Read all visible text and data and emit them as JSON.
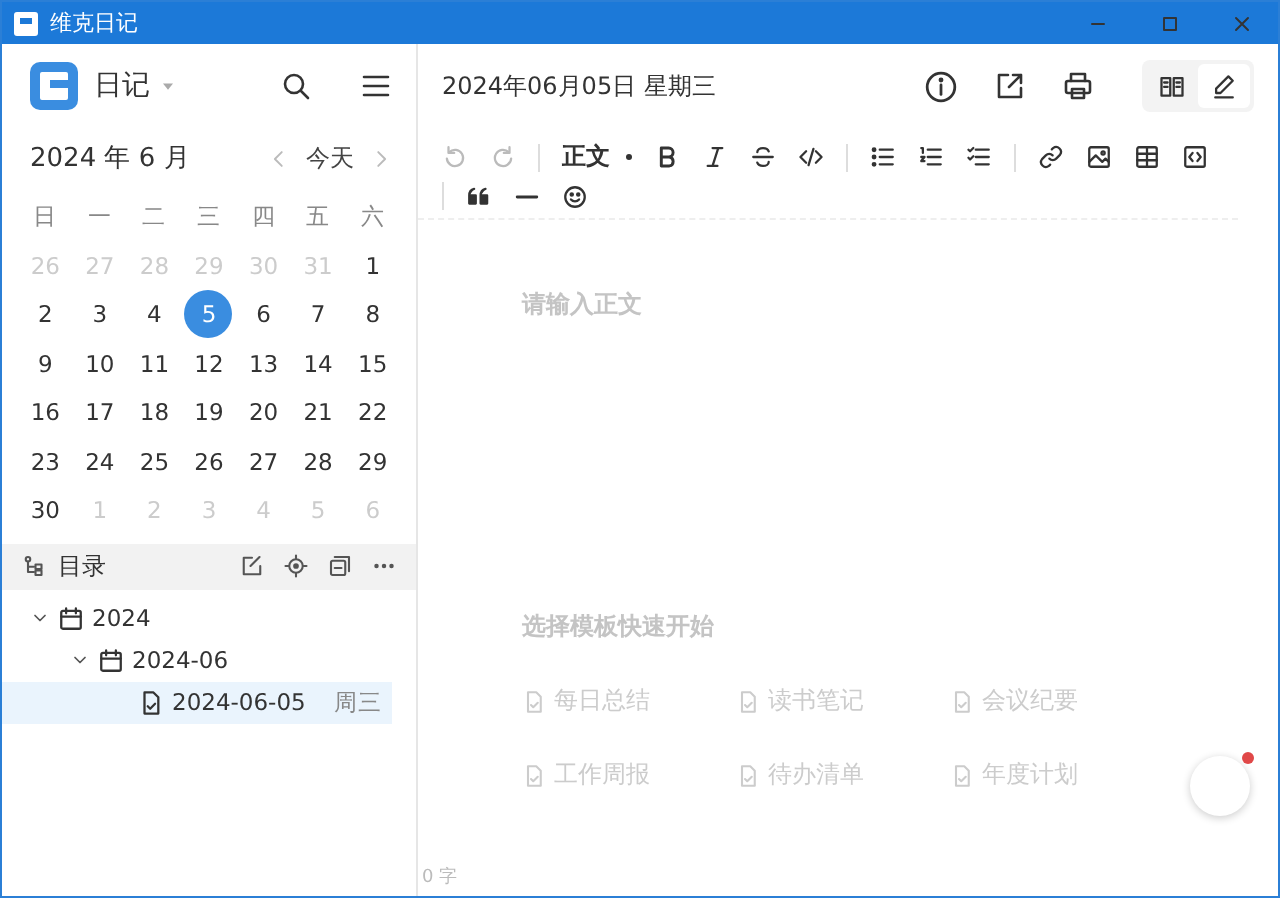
{
  "window": {
    "title": "维克日记"
  },
  "sidebar": {
    "notebook": "日记",
    "month_title": "2024 年 6 月",
    "today_button": "今天",
    "weekdays": [
      "日",
      "一",
      "二",
      "三",
      "四",
      "五",
      "六"
    ],
    "days": [
      {
        "text": "26",
        "muted": true,
        "selected": false
      },
      {
        "text": "27",
        "muted": true,
        "selected": false
      },
      {
        "text": "28",
        "muted": true,
        "selected": false
      },
      {
        "text": "29",
        "muted": true,
        "selected": false
      },
      {
        "text": "30",
        "muted": true,
        "selected": false
      },
      {
        "text": "31",
        "muted": true,
        "selected": false
      },
      {
        "text": "1",
        "muted": false,
        "selected": false
      },
      {
        "text": "2",
        "muted": false,
        "selected": false
      },
      {
        "text": "3",
        "muted": false,
        "selected": false
      },
      {
        "text": "4",
        "muted": false,
        "selected": false
      },
      {
        "text": "5",
        "muted": false,
        "selected": true
      },
      {
        "text": "6",
        "muted": false,
        "selected": false
      },
      {
        "text": "7",
        "muted": false,
        "selected": false
      },
      {
        "text": "8",
        "muted": false,
        "selected": false
      },
      {
        "text": "9",
        "muted": false,
        "selected": false
      },
      {
        "text": "10",
        "muted": false,
        "selected": false
      },
      {
        "text": "11",
        "muted": false,
        "selected": false
      },
      {
        "text": "12",
        "muted": false,
        "selected": false
      },
      {
        "text": "13",
        "muted": false,
        "selected": false
      },
      {
        "text": "14",
        "muted": false,
        "selected": false
      },
      {
        "text": "15",
        "muted": false,
        "selected": false
      },
      {
        "text": "16",
        "muted": false,
        "selected": false
      },
      {
        "text": "17",
        "muted": false,
        "selected": false
      },
      {
        "text": "18",
        "muted": false,
        "selected": false
      },
      {
        "text": "19",
        "muted": false,
        "selected": false
      },
      {
        "text": "20",
        "muted": false,
        "selected": false
      },
      {
        "text": "21",
        "muted": false,
        "selected": false
      },
      {
        "text": "22",
        "muted": false,
        "selected": false
      },
      {
        "text": "23",
        "muted": false,
        "selected": false
      },
      {
        "text": "24",
        "muted": false,
        "selected": false
      },
      {
        "text": "25",
        "muted": false,
        "selected": false
      },
      {
        "text": "26",
        "muted": false,
        "selected": false
      },
      {
        "text": "27",
        "muted": false,
        "selected": false
      },
      {
        "text": "28",
        "muted": false,
        "selected": false
      },
      {
        "text": "29",
        "muted": false,
        "selected": false
      },
      {
        "text": "30",
        "muted": false,
        "selected": false
      },
      {
        "text": "1",
        "muted": true,
        "selected": false
      },
      {
        "text": "2",
        "muted": true,
        "selected": false
      },
      {
        "text": "3",
        "muted": true,
        "selected": false
      },
      {
        "text": "4",
        "muted": true,
        "selected": false
      },
      {
        "text": "5",
        "muted": true,
        "selected": false
      },
      {
        "text": "6",
        "muted": true,
        "selected": false
      }
    ],
    "catalog_title": "目录",
    "tree": [
      {
        "kind": "folder",
        "label": "2024",
        "expanded": true,
        "selected": false,
        "children": [
          {
            "kind": "folder",
            "label": "2024-06",
            "expanded": true,
            "selected": false,
            "children": [
              {
                "kind": "entry",
                "label": "2024-06-05",
                "weekday": "周三",
                "selected": true
              }
            ]
          }
        ]
      }
    ]
  },
  "editor": {
    "date_title": "2024年06月05日 星期三",
    "view_modes": [
      {
        "kind": "read",
        "selected": false
      },
      {
        "kind": "edit",
        "selected": true
      }
    ],
    "toolbar": {
      "undo_disabled": true,
      "redo_disabled": true,
      "heading_style": "正文"
    },
    "placeholder": "请输入正文",
    "templates_title": "选择模板快速开始",
    "templates": [
      "每日总结",
      "读书笔记",
      "会议纪要",
      "工作周报",
      "待办清单",
      "年度计划"
    ],
    "word_count": "0 字",
    "help_badge": true
  }
}
